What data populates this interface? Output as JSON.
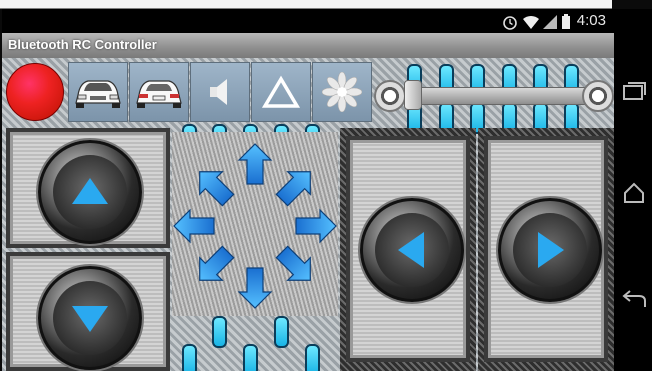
{
  "status_bar": {
    "time": "4:03",
    "icons": [
      "alarm-icon",
      "wifi-icon",
      "cell-signal-icon",
      "battery-icon"
    ]
  },
  "app": {
    "title": "Bluetooth RC Controller"
  },
  "toolbar": {
    "buttons": [
      "stop-button",
      "front-lights-button",
      "rear-lights-button",
      "horn-button",
      "hazard-button",
      "extra-button"
    ]
  },
  "speed_slider": {
    "value": 0
  },
  "nav_bar": {
    "buttons": [
      "recent-apps-icon",
      "home-icon",
      "back-icon"
    ]
  },
  "colors": {
    "accent_cyan": "#1fa6e8",
    "stop_red": "#e22222",
    "toolbar_blue": "#8aa1b6"
  }
}
